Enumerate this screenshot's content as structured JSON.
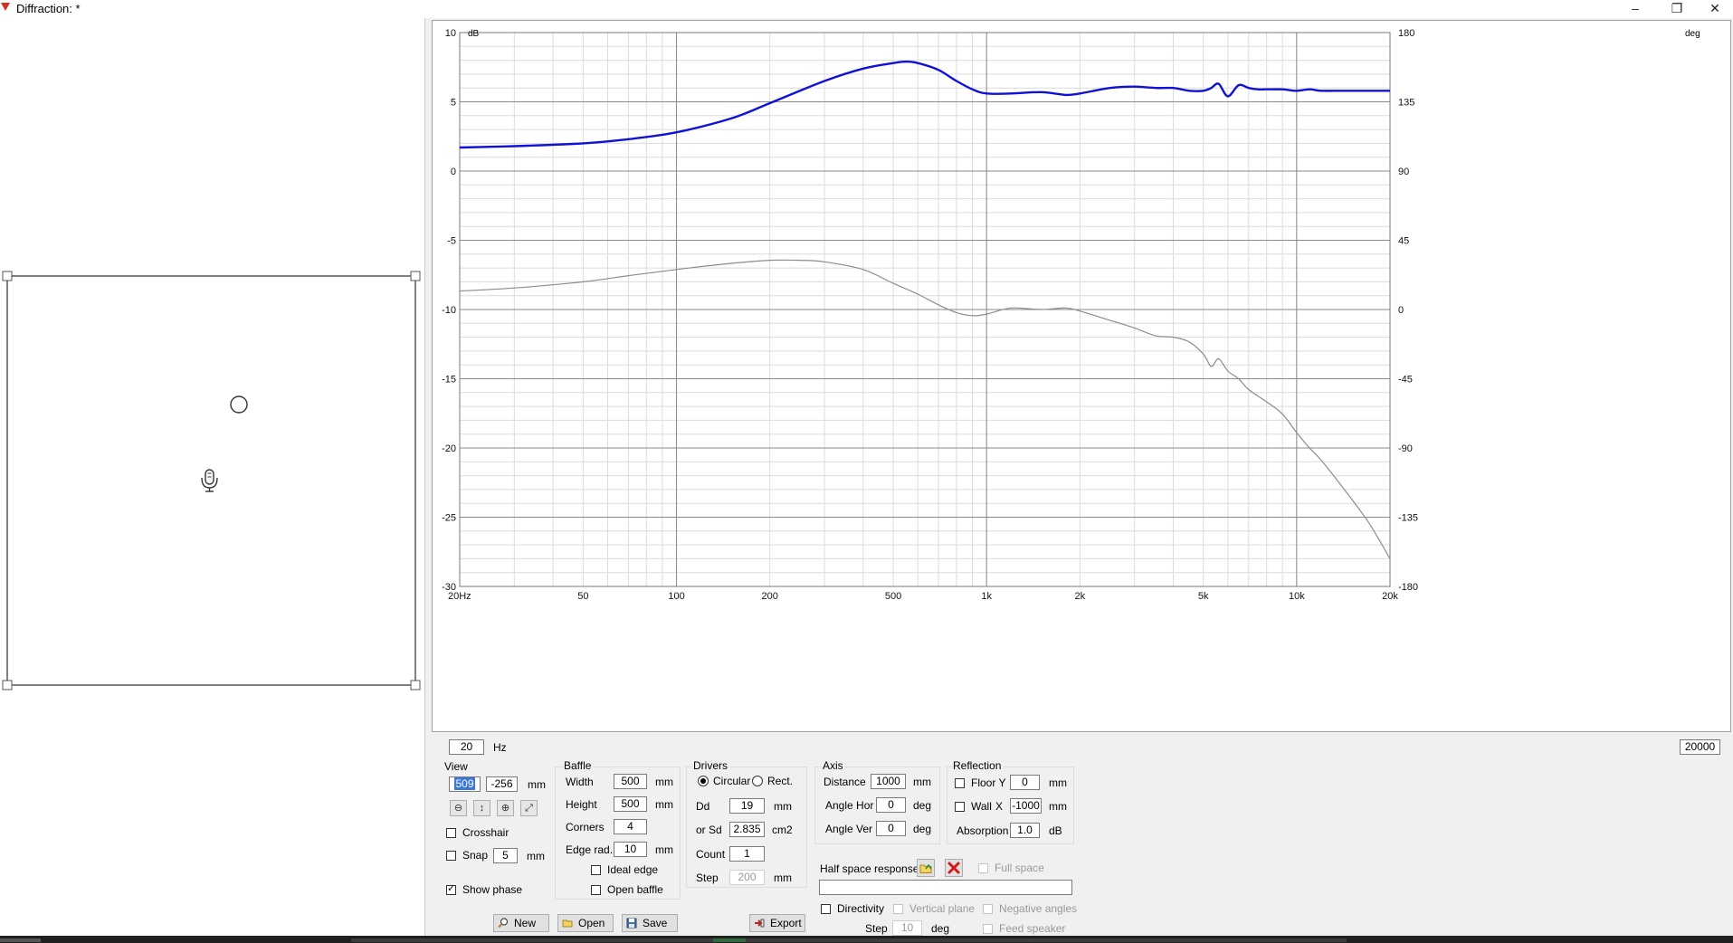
{
  "window": {
    "title": "Diffraction: *",
    "minimize": "–",
    "restore": "❐",
    "close": "✕"
  },
  "plot": {
    "left_unit": "dB",
    "right_unit": "deg",
    "x_ticks": [
      "20Hz",
      "50",
      "100",
      "200",
      "500",
      "1k",
      "2k",
      "5k",
      "10k",
      "20k"
    ],
    "x_tick_freqs": [
      20,
      50,
      100,
      200,
      500,
      1000,
      2000,
      5000,
      10000,
      20000
    ],
    "y_left_ticks": [
      "10",
      "5",
      "0",
      "-5",
      "-10",
      "-15",
      "-20",
      "-25",
      "-30"
    ],
    "y_right_ticks": [
      "180",
      "135",
      "90",
      "45",
      "0",
      "-45",
      "-90",
      "-135",
      "-180"
    ],
    "freq_min": "20",
    "freq_min_unit": "Hz",
    "freq_max": "20000",
    "colors": {
      "magnitude": "#1010d8",
      "phase": "#8c8c8c",
      "grid_major": "#8a8a8a",
      "grid_minor": "#dcdcdc"
    }
  },
  "chart_data": {
    "type": "line",
    "xscale": "log",
    "xlim": [
      20,
      20000
    ],
    "ylim": [
      -30,
      10
    ],
    "y2lim": [
      -180,
      180
    ],
    "ylabel": "dB",
    "y2label": "deg",
    "series": [
      {
        "axis": "left",
        "x": [
          20,
          30,
          50,
          70,
          100,
          150,
          200,
          300,
          400,
          500,
          550,
          600,
          700,
          800,
          900,
          1000,
          1200,
          1500,
          1800,
          2000,
          2500,
          3000,
          3500,
          4000,
          4500,
          5000,
          5300,
          5600,
          6000,
          6500,
          7000,
          7500,
          8000,
          9000,
          10000,
          11000,
          12000,
          14000,
          17000,
          20000
        ],
        "y": [
          1.7,
          1.8,
          2.0,
          2.3,
          2.8,
          3.8,
          4.9,
          6.5,
          7.4,
          7.8,
          7.9,
          7.8,
          7.3,
          6.5,
          5.9,
          5.6,
          5.6,
          5.7,
          5.5,
          5.6,
          6.0,
          6.1,
          6.0,
          6.0,
          5.8,
          5.8,
          6.0,
          6.3,
          5.4,
          6.2,
          6.0,
          5.9,
          5.9,
          5.9,
          5.8,
          5.9,
          5.8,
          5.8,
          5.8,
          5.8
        ]
      },
      {
        "axis": "right",
        "x": [
          20,
          30,
          50,
          70,
          100,
          150,
          200,
          250,
          300,
          400,
          500,
          600,
          700,
          800,
          900,
          1000,
          1200,
          1500,
          1800,
          2000,
          2500,
          3000,
          3500,
          4000,
          4500,
          5000,
          5300,
          5600,
          6000,
          6500,
          7000,
          8000,
          9000,
          10000,
          11000,
          12000,
          14000,
          17000,
          20000
        ],
        "y": [
          12,
          14,
          18,
          22,
          26,
          30,
          32,
          32,
          31,
          26,
          17,
          10,
          3,
          -2,
          -4,
          -3,
          1,
          0,
          1,
          -1,
          -7,
          -12,
          -17,
          -18,
          -21,
          -29,
          -37,
          -32,
          -40,
          -45,
          -52,
          -60,
          -68,
          -80,
          -90,
          -98,
          -115,
          -138,
          -162
        ]
      }
    ]
  },
  "view": {
    "title": "View",
    "x": "509",
    "y": "-256",
    "unit": "mm",
    "crosshair": "Crosshair",
    "snap": "Snap",
    "snap_value": "5",
    "snap_unit": "mm",
    "show_phase": "Show phase"
  },
  "baffle": {
    "title": "Baffle",
    "width_label": "Width",
    "width": "500",
    "height_label": "Height",
    "height": "500",
    "corners_label": "Corners",
    "corners": "4",
    "edge_label": "Edge rad.",
    "edge": "10",
    "unit": "mm",
    "ideal_edge": "Ideal edge",
    "open_baffle": "Open baffle"
  },
  "drivers": {
    "title": "Drivers",
    "circular": "Circular",
    "rect": "Rect.",
    "dd_label": "Dd",
    "dd": "19",
    "dd_unit": "mm",
    "sd_label": "or Sd",
    "sd": "2.835",
    "sd_unit": "cm2",
    "count_label": "Count",
    "count": "1",
    "step_label": "Step",
    "step": "200",
    "step_unit": "mm"
  },
  "axis": {
    "title": "Axis",
    "distance_label": "Distance",
    "distance": "1000",
    "distance_unit": "mm",
    "angle_hor_label": "Angle Hor",
    "angle_hor": "0",
    "angle_ver_label": "Angle Ver",
    "angle_ver": "0",
    "deg": "deg"
  },
  "reflection": {
    "title": "Reflection",
    "floor": "Floor Y",
    "floor_value": "0",
    "wall": "Wall",
    "wall_axis": "X",
    "wall_value": "-1000",
    "unit": "mm",
    "absorption_label": "Absorption",
    "absorption": "1.0",
    "absorption_unit": "dB"
  },
  "half_space": {
    "label": "Half space response",
    "full_space": "Full space",
    "directivity": "Directivity",
    "vertical_plane": "Vertical plane",
    "negative_angles": "Negative angles",
    "step_label": "Step",
    "step": "10",
    "step_unit": "deg",
    "feed_speaker": "Feed speaker"
  },
  "buttons": {
    "new": "New",
    "open": "Open",
    "save": "Save",
    "export": "Export"
  }
}
